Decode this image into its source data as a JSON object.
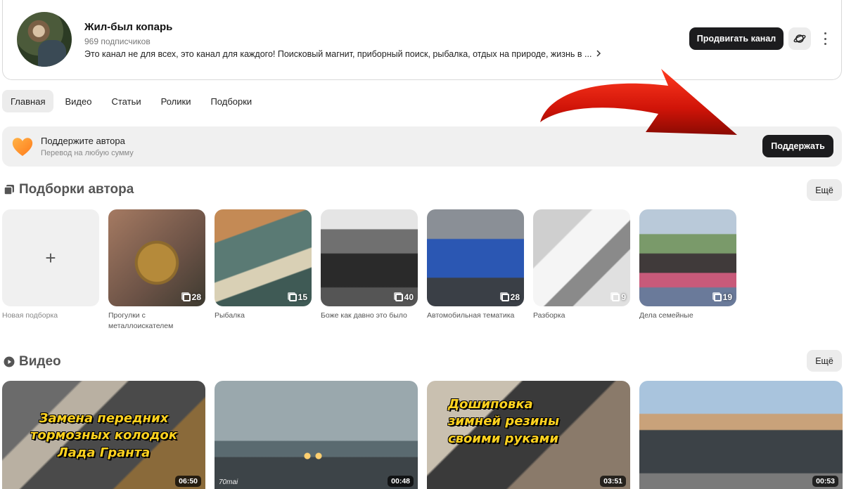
{
  "channel": {
    "name": "Жил-был копарь",
    "subscribers": "969 подписчиков",
    "description": "Это канал не для всех, это канал для каждого! Поисковый магнит, приборный поиск, рыбалка, отдых на природе, жизнь в ...",
    "promote_label": "Продвигать канал"
  },
  "tabs": [
    {
      "label": "Главная",
      "active": true
    },
    {
      "label": "Видео"
    },
    {
      "label": "Статьи"
    },
    {
      "label": "Ролики"
    },
    {
      "label": "Подборки"
    }
  ],
  "support": {
    "title": "Поддержите автора",
    "subtitle": "Перевод на любую сумму",
    "button_label": "Поддержать"
  },
  "collections_section": {
    "title": "Подборки автора",
    "more_label": "Ещё",
    "new_label": "Новая подборка",
    "new_symbol": "+",
    "items": [
      {
        "label": "Прогулки с металлоискателем",
        "count": "28"
      },
      {
        "label": "Рыбалка",
        "count": "15"
      },
      {
        "label": "Боже как давно это было",
        "count": "40"
      },
      {
        "label": "Автомобильная тематика",
        "count": "28"
      },
      {
        "label": "Разборка",
        "count": "9"
      },
      {
        "label": "Дела семейные",
        "count": "19"
      }
    ]
  },
  "videos_section": {
    "title": "Видео",
    "more_label": "Ещё",
    "items": [
      {
        "overlay": "Замена передних\nтормозных колодок\nЛада Гранта",
        "duration": "06:50"
      },
      {
        "overlay": "",
        "watermark": "70mai",
        "duration": "00:48"
      },
      {
        "overlay": "Дошиповка\n   зимней резины\n        своими руками",
        "duration": "03:51"
      },
      {
        "overlay": "",
        "duration": "00:53"
      }
    ]
  },
  "colors": {
    "primary_button": "#1c1c1e",
    "tab_active_bg": "#ececec",
    "support_bg": "#f0f0f0",
    "overlay_text": "#ffd21f",
    "annotation_arrow": "#e02010"
  }
}
